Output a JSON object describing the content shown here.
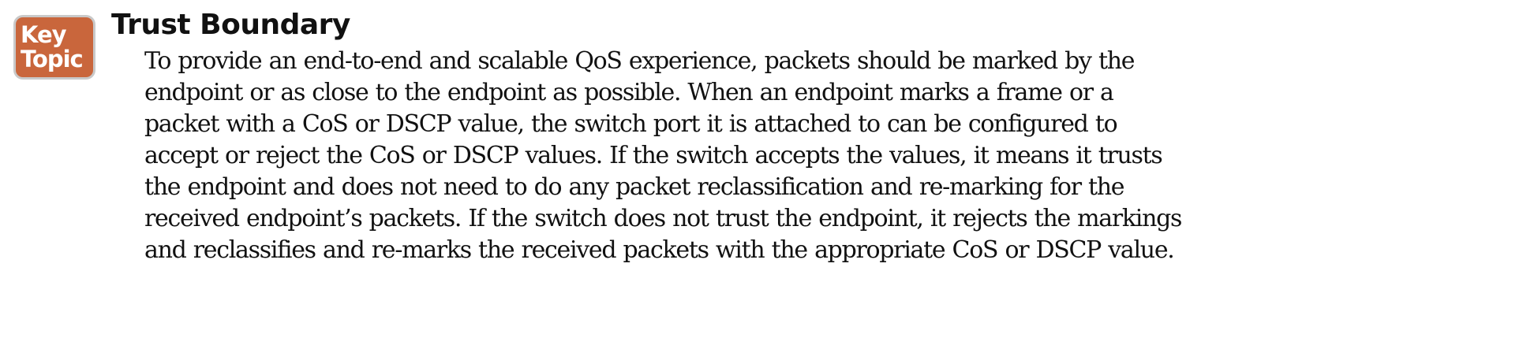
{
  "badge": {
    "line1": "Key",
    "line2": "Topic",
    "color": "#c9663c"
  },
  "section": {
    "title": "Trust Boundary",
    "lines": [
      "To provide an end-to-end and scalable QoS experience, packets should be marked by the",
      "endpoint or as close to the endpoint as possible. When an endpoint marks a frame or a",
      "packet with a CoS or DSCP value, the switch port it is attached to can be configured to",
      "accept or reject the CoS or DSCP values. If the switch accepts the values, it means it trusts",
      "the endpoint and does not need to do any packet reclassification and re-marking for the",
      "received endpoint’s packets. If the switch does not trust the endpoint, it rejects the markings",
      "and reclassifies and re-marks the received packets with the appropriate CoS or DSCP value."
    ]
  }
}
